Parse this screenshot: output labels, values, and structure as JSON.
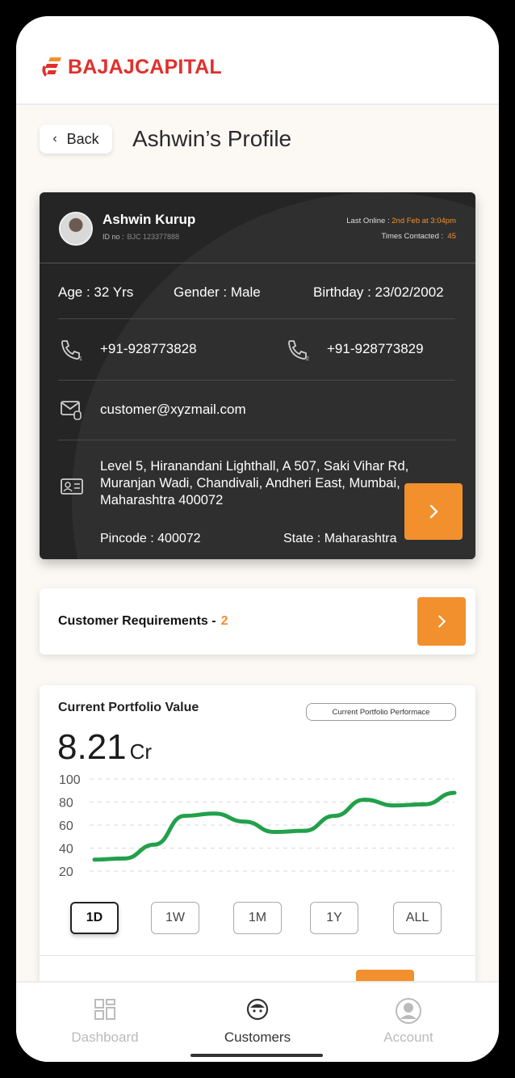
{
  "brand": {
    "name": "BAJAJCAPITAL",
    "color": "#e0302c"
  },
  "header": {
    "back_label": "Back",
    "title": "Ashwin’s Profile"
  },
  "profile": {
    "name": "Ashwin Kurup",
    "id_label": "ID no :",
    "id_value": "BJC 123377888",
    "last_online_label": "Last Online :",
    "last_online_value": "2nd Feb at 3:04pm",
    "times_contacted_label": "Times Contacted :",
    "times_contacted_value": "45",
    "age": "Age : 32 Yrs",
    "gender": "Gender : Male",
    "birthday": "Birthday : 23/02/2002",
    "phone1": "+91-928773828",
    "phone2": "+91-928773829",
    "email": "customer@xyzmail.com",
    "address": "Level 5, Hiranandani Lighthall, A 507, Saki Vihar Rd, Muranjan Wadi, Chandivali, Andheri East, Mumbai, Maharashtra 400072",
    "pincode": "Pincode : 400072",
    "state": "State : Maharashtra"
  },
  "requirements": {
    "label": "Customer Requirements",
    "dash": "-",
    "count": "2"
  },
  "portfolio": {
    "title": "Current Portfolio Value",
    "performance_label": "Current Portfolio Performace",
    "value": "8.21",
    "unit": "Cr",
    "ranges": [
      "1D",
      "1W",
      "1M",
      "1Y",
      "ALL"
    ],
    "selected_range": "1D"
  },
  "chart_data": {
    "type": "line",
    "title": "",
    "xlabel": "",
    "ylabel": "",
    "ylim": [
      20,
      100
    ],
    "yticks": [
      100,
      80,
      60,
      40,
      20
    ],
    "grid": true,
    "series": [
      {
        "values": [
          30,
          31,
          43,
          68,
          70,
          63,
          54,
          55,
          68,
          82,
          77,
          78,
          88
        ],
        "color": "#22a04b"
      }
    ]
  },
  "nav": {
    "items": [
      {
        "label": "Dashboard"
      },
      {
        "label": "Customers"
      },
      {
        "label": "Account"
      }
    ],
    "active": "Customers"
  },
  "colors": {
    "accent": "#f2902e",
    "card_dark": "#252525",
    "line": "#22a04b"
  }
}
